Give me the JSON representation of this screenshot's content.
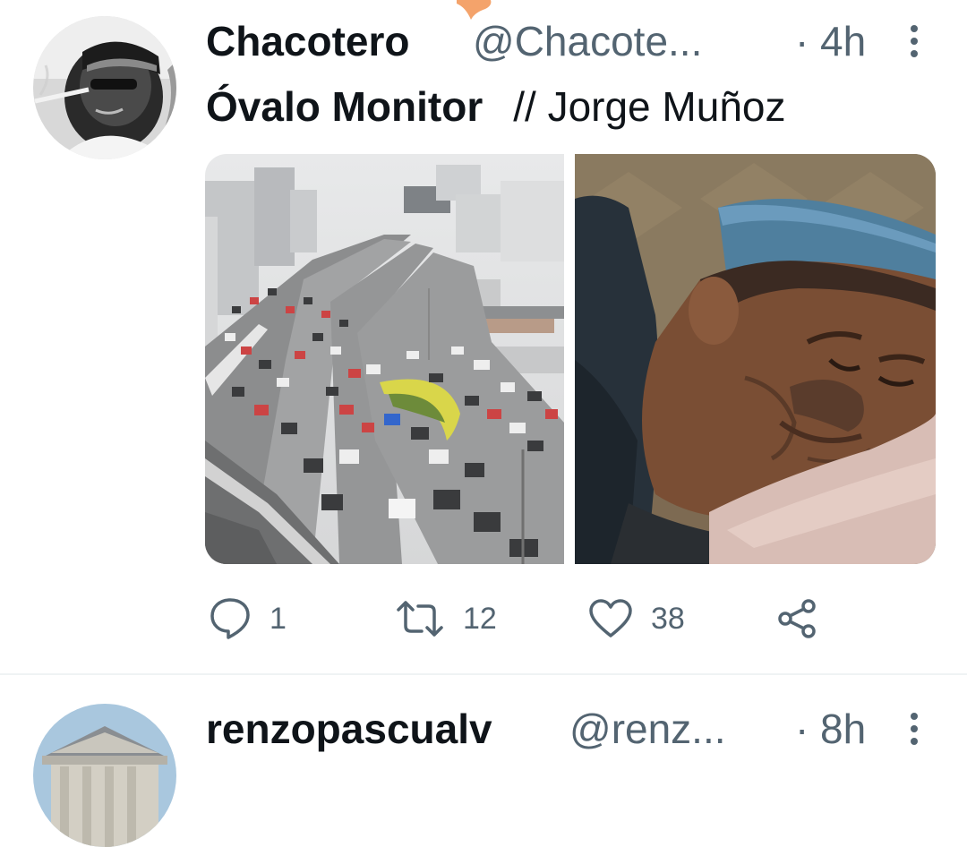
{
  "tweets": [
    {
      "display_name": "Chacotero",
      "handle": "@Chacote...",
      "separator": "·",
      "time": "4h",
      "text_bold": "Óvalo Monitor",
      "text_rest": "// Jorge Muñoz",
      "images": [
        "traffic-overpass-photo",
        "sleeping-man-photo"
      ],
      "counts": {
        "replies": "1",
        "retweets": "12",
        "likes": "38"
      }
    },
    {
      "display_name": "renzopascualv",
      "handle": "@renz...",
      "separator": "·",
      "time": "8h"
    }
  ],
  "icons": {
    "more": "vertical-ellipsis-icon",
    "reply": "speech-bubble-icon",
    "retweet": "retweet-arrows-icon",
    "like": "heart-icon",
    "share": "share-nodes-icon"
  },
  "colors": {
    "text": "#0f1419",
    "secondary": "#536471",
    "divider": "#eff3f4",
    "notification": "#f4a36b"
  }
}
